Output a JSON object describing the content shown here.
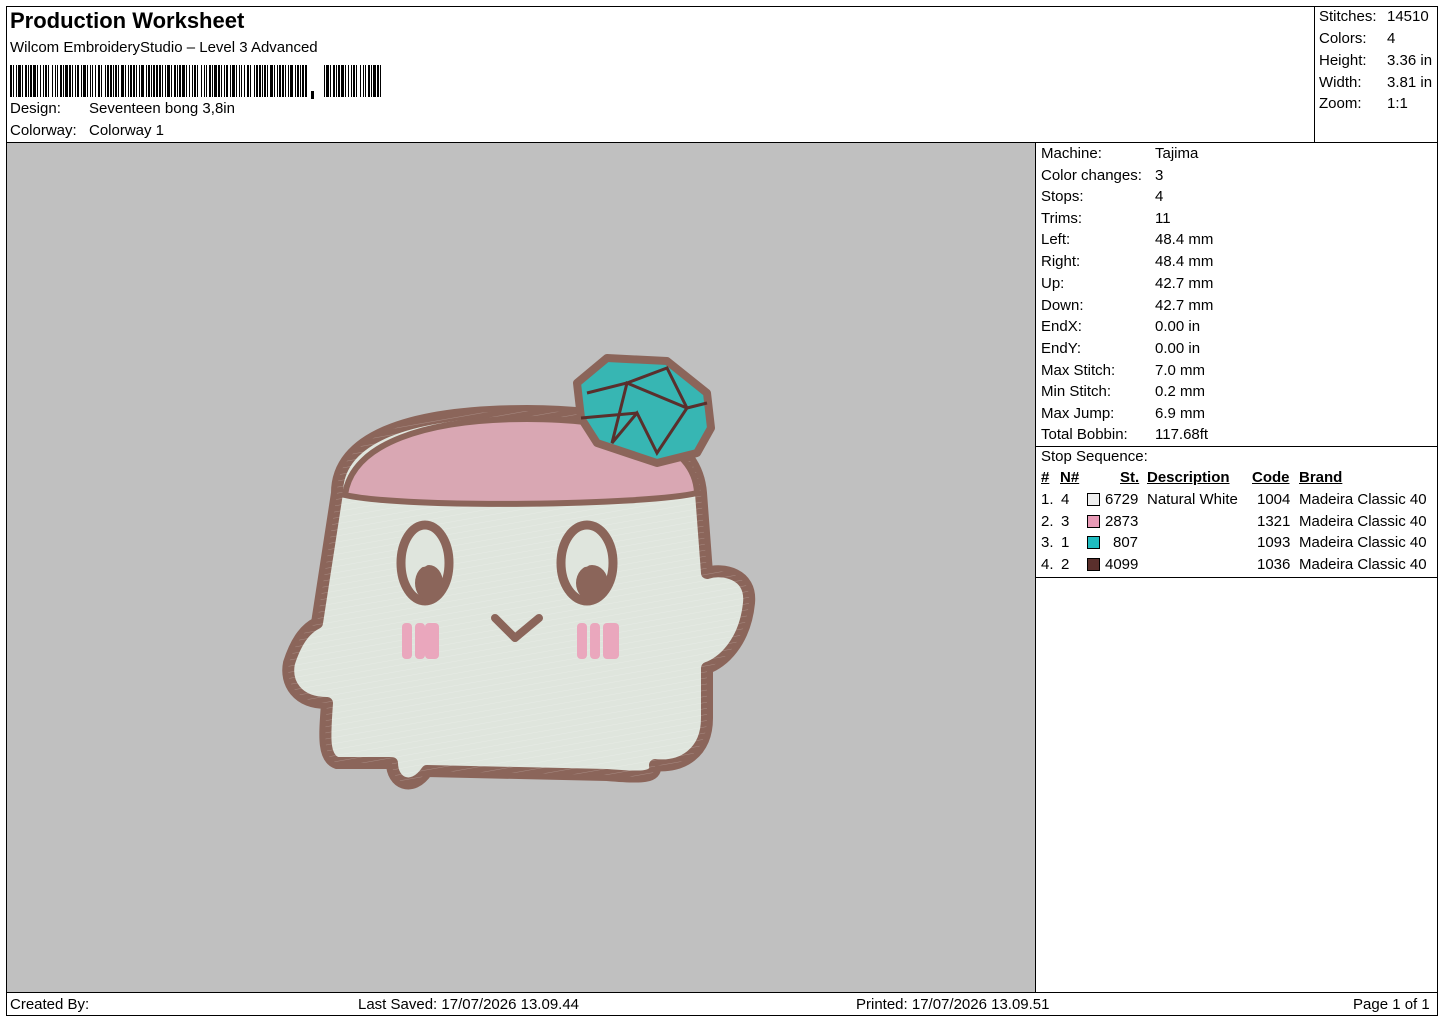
{
  "header": {
    "title": "Production Worksheet",
    "subtitle": "Wilcom EmbroideryStudio – Level 3 Advanced",
    "design_label": "Design:",
    "design_value": "Seventeen bong 3,8in",
    "colorway_label": "Colorway:",
    "colorway_value": "Colorway 1"
  },
  "summary": [
    {
      "label": "Stitches:",
      "value": "14510"
    },
    {
      "label": "Colors:",
      "value": "4"
    },
    {
      "label": "Height:",
      "value": "3.36 in"
    },
    {
      "label": "Width:",
      "value": "3.81 in"
    },
    {
      "label": "Zoom:",
      "value": "1:1"
    }
  ],
  "machine_info": [
    {
      "label": "Machine:",
      "value": "Tajima"
    },
    {
      "label": "Color changes:",
      "value": "3"
    },
    {
      "label": "Stops:",
      "value": "4"
    },
    {
      "label": "Trims:",
      "value": "11"
    },
    {
      "label": "Left:",
      "value": "48.4 mm"
    },
    {
      "label": "Right:",
      "value": "48.4 mm"
    },
    {
      "label": "Up:",
      "value": "42.7 mm"
    },
    {
      "label": "Down:",
      "value": "42.7 mm"
    },
    {
      "label": "EndX:",
      "value": "0.00 in"
    },
    {
      "label": "EndY:",
      "value": "0.00 in"
    },
    {
      "label": "Max Stitch:",
      "value": "7.0 mm"
    },
    {
      "label": "Min Stitch:",
      "value": "0.2 mm"
    },
    {
      "label": "Max Jump:",
      "value": "6.9 mm"
    },
    {
      "label": "Total Bobbin:",
      "value": "117.68ft"
    }
  ],
  "stop_sequence": {
    "title": "Stop Sequence:",
    "headers": [
      "#",
      "N#",
      "St.",
      "Description",
      "Code",
      "Brand"
    ],
    "rows": [
      {
        "num": "1.",
        "n": "4",
        "color": "#eeeeee",
        "st": "6729",
        "desc": "Natural White",
        "code": "1004",
        "brand": "Madeira Classic 40"
      },
      {
        "num": "2.",
        "n": "3",
        "color": "#e89ab6",
        "st": "2873",
        "desc": "",
        "code": "1321",
        "brand": "Madeira Classic 40"
      },
      {
        "num": "3.",
        "n": "1",
        "color": "#1fbcc0",
        "st": "807",
        "desc": "",
        "code": "1093",
        "brand": "Madeira Classic 40"
      },
      {
        "num": "4.",
        "n": "2",
        "color": "#5a2f2c",
        "st": "4099",
        "desc": "",
        "code": "1036",
        "brand": "Madeira Classic 40"
      }
    ]
  },
  "footer": {
    "created_by": "Created By:",
    "last_saved": "Last Saved: 17/07/2026 13.09.44",
    "printed": "Printed: 17/07/2026 13.09.51",
    "page": "Page 1 of 1"
  },
  "design_colors": {
    "body": "#dfe5dd",
    "outline": "#8b655a",
    "hat": "#d9a7b3",
    "gem": "#37b6b3",
    "blush": "#eaa7bd",
    "background": "#c0c0c0"
  }
}
